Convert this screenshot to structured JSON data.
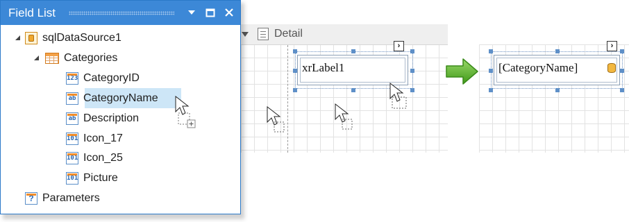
{
  "field_list": {
    "title": "Field List",
    "datasource": "sqlDataSource1",
    "table": "Categories",
    "fields": [
      {
        "label": "CategoryID",
        "icon": "field-number-icon",
        "badge": "123"
      },
      {
        "label": "CategoryName",
        "icon": "field-string-icon",
        "badge": "ab"
      },
      {
        "label": "Description",
        "icon": "field-string-icon",
        "badge": "ab"
      },
      {
        "label": "Icon_17",
        "icon": "field-binary-icon",
        "badge": "101"
      },
      {
        "label": "Icon_25",
        "icon": "field-binary-icon",
        "badge": "101"
      },
      {
        "label": "Picture",
        "icon": "field-binary-icon",
        "badge": "101"
      }
    ],
    "parameters": "Parameters",
    "parameters_badge": "?"
  },
  "designer": {
    "band_title": "Detail",
    "label_before": "xrLabel1",
    "label_after": "[CategoryName]",
    "smart_tag_glyph": "›"
  },
  "colors": {
    "title_bar": "#3c88d7",
    "selection": "#cde6f7",
    "arrow": "#5fb92c"
  }
}
